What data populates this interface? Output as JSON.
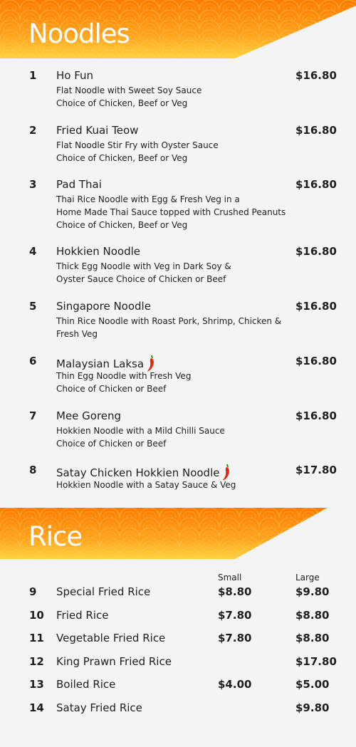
{
  "sections": {
    "noodles": {
      "title": "Noodles"
    },
    "rice": {
      "title": "Rice",
      "col_small": "Small",
      "col_large": "Large"
    }
  },
  "colors": {
    "banner_start": "#ff8a00",
    "banner_end": "#ffd23f",
    "accent": "#e8250e"
  },
  "noodles": [
    {
      "num": "1",
      "name": "Ho Fun",
      "price": "$16.80",
      "desc": "Flat Noodle with Sweet Soy Sauce\nChoice of Chicken, Beef or Veg"
    },
    {
      "num": "2",
      "name": "Fried Kuai Teow",
      "price": "$16.80",
      "desc": "Flat Noodle Stir Fry with Oyster Sauce\nChoice of Chicken, Beef or Veg"
    },
    {
      "num": "3",
      "name": "Pad Thai",
      "price": "$16.80",
      "desc": "Thai Rice Noodle with Egg & Fresh Veg in a\nHome Made Thai Sauce topped with Crushed Peanuts\nChoice of Chicken, Beef or Veg"
    },
    {
      "num": "4",
      "name": "Hokkien Noodle",
      "price": "$16.80",
      "desc": "Thick Egg Noodle with Veg in Dark Soy &\nOyster Sauce Choice of Chicken or Beef"
    },
    {
      "num": "5",
      "name": "Singapore Noodle",
      "price": "$16.80",
      "desc": "Thin Rice Noodle with Roast Pork, Shrimp, Chicken &\nFresh Veg"
    },
    {
      "num": "6",
      "name": "Malaysian Laksa",
      "price": "$16.80",
      "desc": "Thin Egg Noodle with Fresh Veg\nChoice of Chicken or Beef",
      "spicy": true
    },
    {
      "num": "7",
      "name": "Mee Goreng",
      "price": "$16.80",
      "desc": "Hokkien Noodle with a Mild Chilli Sauce\nChoice of Chicken or Beef"
    },
    {
      "num": "8",
      "name": "Satay Chicken Hokkien Noodle",
      "price": "$17.80",
      "desc": "Hokkien Noodle with a Satay Sauce & Veg",
      "spicy": true
    }
  ],
  "rice": [
    {
      "num": "9",
      "name": "Special Fried Rice",
      "small": "$8.80",
      "large": "$9.80"
    },
    {
      "num": "10",
      "name": "Fried Rice",
      "small": "$7.80",
      "large": "$8.80"
    },
    {
      "num": "11",
      "name": "Vegetable Fried Rice",
      "small": "$7.80",
      "large": "$8.80"
    },
    {
      "num": "12",
      "name": "King Prawn Fried Rice",
      "small": "",
      "large": "$17.80"
    },
    {
      "num": "13",
      "name": "Boiled Rice",
      "small": "$4.00",
      "large": "$5.00"
    },
    {
      "num": "14",
      "name": "Satay Fried Rice",
      "small": "",
      "large": "$9.80"
    }
  ]
}
